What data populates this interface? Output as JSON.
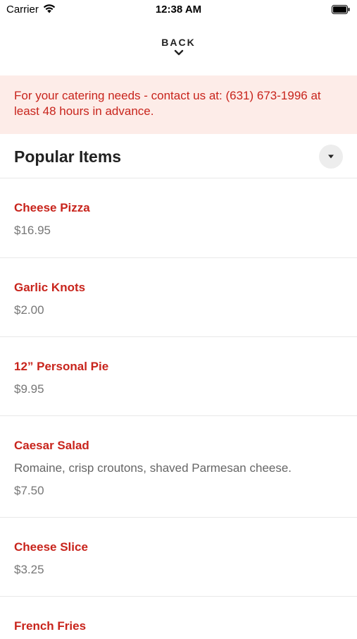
{
  "status_bar": {
    "carrier": "Carrier",
    "time": "12:38 AM"
  },
  "nav": {
    "back_label": "BACK"
  },
  "notice": {
    "text": "For your catering needs - contact us at: (631) 673-1996 at least 48 hours in advance."
  },
  "section": {
    "title": "Popular Items"
  },
  "items": [
    {
      "name": "Cheese Pizza",
      "description": "",
      "price": "$16.95"
    },
    {
      "name": "Garlic Knots",
      "description": "",
      "price": "$2.00"
    },
    {
      "name": "12” Personal Pie",
      "description": "",
      "price": "$9.95"
    },
    {
      "name": "Caesar Salad",
      "description": "Romaine, crisp croutons, shaved Parmesan cheese.",
      "price": "$7.50"
    },
    {
      "name": "Cheese Slice",
      "description": "",
      "price": "$3.25"
    },
    {
      "name": "French Fries",
      "description": "",
      "price": ""
    }
  ],
  "colors": {
    "accent": "#c8241c",
    "notice_bg": "#fdece8"
  }
}
